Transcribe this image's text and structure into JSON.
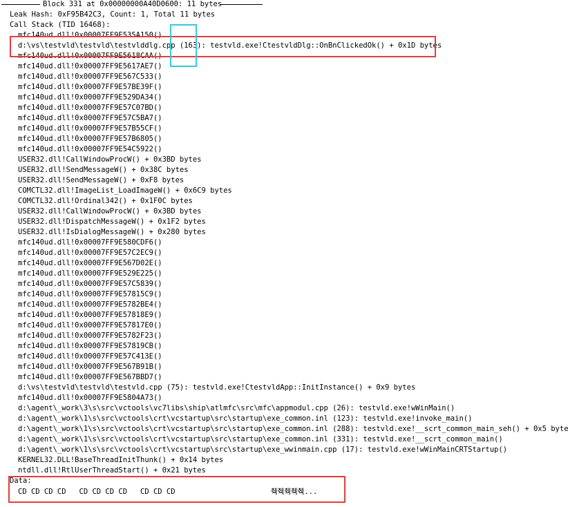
{
  "header": {
    "title": "Block 331 at 0x00000000A40D0600: 11 bytes"
  },
  "leak_hash": "Leak Hash: 0xF95B42C3, Count: 1, Total 11 bytes",
  "call_stack_label": "Call Stack (TID 16468):",
  "frames": [
    "mfc140ud.dll!0x00007FF9E535A150()",
    "d:\\vs\\testvld\\testvld\\testvlddlg.cpp (163): testvld.exe!CtestvldDlg::OnBnClickedOk() + 0x1D bytes",
    "mfc140ud.dll!0x00007FF9E5618CAA()",
    "mfc140ud.dll!0x00007FF9E5617AE7()",
    "mfc140ud.dll!0x00007FF9E567C533()",
    "mfc140ud.dll!0x00007FF9E57BE39F()",
    "mfc140ud.dll!0x00007FF9E529DA34()",
    "mfc140ud.dll!0x00007FF9E57C07BD()",
    "mfc140ud.dll!0x00007FF9E57C5BA7()",
    "mfc140ud.dll!0x00007FF9E57B55CF()",
    "mfc140ud.dll!0x00007FF9E57B6805()",
    "mfc140ud.dll!0x00007FF9E54C5922()",
    "USER32.dll!CallWindowProcW() + 0x3BD bytes",
    "USER32.dll!SendMessageW() + 0x38C bytes",
    "USER32.dll!SendMessageW() + 0xF8 bytes",
    "COMCTL32.dll!ImageList_LoadImageW() + 0x6C9 bytes",
    "COMCTL32.dll!Ordinal342() + 0x1F0C bytes",
    "USER32.dll!CallWindowProcW() + 0x3BD bytes",
    "USER32.dll!DispatchMessageW() + 0x1F2 bytes",
    "USER32.dll!IsDialogMessageW() + 0x280 bytes",
    "mfc140ud.dll!0x00007FF9E580CDF6()",
    "mfc140ud.dll!0x00007FF9E57C2EC9()",
    "mfc140ud.dll!0x00007FF9E567D02E()",
    "mfc140ud.dll!0x00007FF9E529E225()",
    "mfc140ud.dll!0x00007FF9E57C5839()",
    "mfc140ud.dll!0x00007FF9E57815C9()",
    "mfc140ud.dll!0x00007FF9E5782BE4()",
    "mfc140ud.dll!0x00007FF9E57818E9()",
    "mfc140ud.dll!0x00007FF9E57817E0()",
    "mfc140ud.dll!0x00007FF9E5782F23()",
    "mfc140ud.dll!0x00007FF9E57819CB()",
    "mfc140ud.dll!0x00007FF9E57C413E()",
    "mfc140ud.dll!0x00007FF9E567B91B()",
    "mfc140ud.dll!0x00007FF9E567BBD7()",
    "d:\\vs\\testvld\\testvld\\testvld.cpp (75): testvld.exe!CtestvldApp::InitInstance() + 0x9 bytes",
    "mfc140ud.dll!0x00007FF9E5804A73()",
    "d:\\agent\\_work\\3\\s\\src\\vctools\\vc7libs\\ship\\atlmfc\\src\\mfc\\appmodul.cpp (26): testvld.exe!wWinMain()",
    "d:\\agent\\_work\\1\\s\\src\\vctools\\crt\\vcstartup\\src\\startup\\exe_common.inl (123): testvld.exe!invoke_main()",
    "d:\\agent\\_work\\1\\s\\src\\vctools\\crt\\vcstartup\\src\\startup\\exe_common.inl (288): testvld.exe!__scrt_common_main_seh() + 0x5 bytes",
    "d:\\agent\\_work\\1\\s\\src\\vctools\\crt\\vcstartup\\src\\startup\\exe_common.inl (331): testvld.exe!__scrt_common_main()",
    "d:\\agent\\_work\\1\\s\\src\\vctools\\crt\\vcstartup\\src\\startup\\exe_wwinmain.cpp (17): testvld.exe!wWinMainCRTStartup()",
    "KERNEL32.DLL!BaseThreadInitThunk() + 0x14 bytes",
    "ntdll.dll!RtlUserThreadStart() + 0x21 bytes"
  ],
  "data_section": {
    "label": "Data:",
    "hex_bytes": "CD CD CD CD   CD CD CD CD   CD CD CD",
    "ascii": "췍췍췍췍췍..."
  },
  "highlights": {
    "red_color": "#e53b3b",
    "cyan_color": "#33ccd6"
  }
}
